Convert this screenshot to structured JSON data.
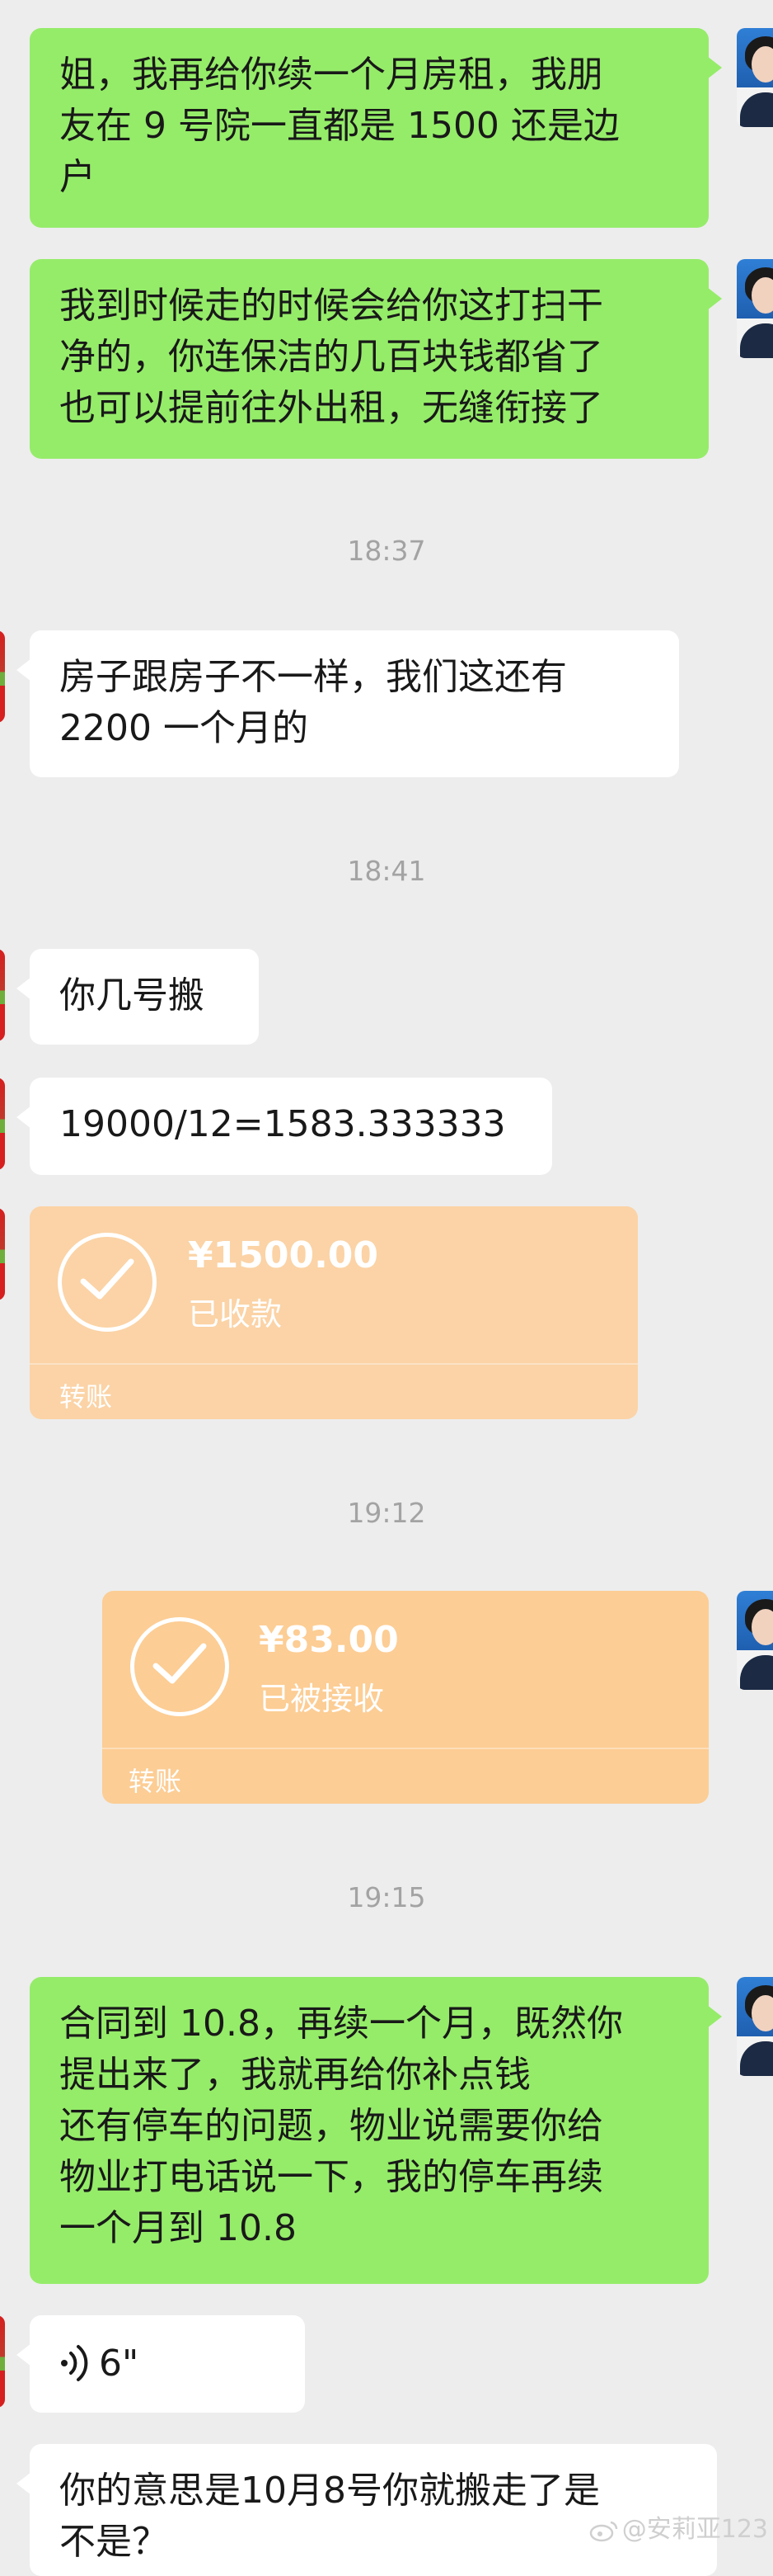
{
  "messages": [
    {
      "id": "m1",
      "side": "right",
      "text": "姐，我再给你续一个月房租，我朋\n友在 9 号院一直都是 1500 还是边\n户"
    },
    {
      "id": "m2",
      "side": "right",
      "text": "我到时候走的时候会给你这打扫干\n净的，你连保洁的几百块钱都省了\n也可以提前往外出租，无缝衔接了"
    },
    {
      "id": "m3",
      "side": "left",
      "text": "房子跟房子不一样，我们这还有\n2200 一个月的"
    },
    {
      "id": "m4",
      "side": "left",
      "text": "你几号搬"
    },
    {
      "id": "m5",
      "side": "left",
      "text": "19000/12=1583.333333"
    },
    {
      "id": "m6",
      "side": "right",
      "text": "合同到 10.8，再续一个月，既然你\n提出来了，我就再给你补点钱\n还有停车的问题，物业说需要你给\n物业打电话说一下，我的停车再续\n一个月到 10.8"
    },
    {
      "id": "m7",
      "side": "left",
      "text": "你的意思是10月8号你就搬走了是\n不是？"
    }
  ],
  "timestamps": [
    "18:37",
    "18:41",
    "19:12",
    "19:15"
  ],
  "transfers": [
    {
      "side": "left",
      "amount": "¥1500.00",
      "status": "已收款",
      "label": "转账"
    },
    {
      "side": "right",
      "amount": "¥83.00",
      "status": "已被接收",
      "label": "转账"
    }
  ],
  "voice": {
    "duration": "6\""
  },
  "watermark": {
    "text": "@安莉亚123"
  },
  "colors": {
    "background": "#ededed",
    "bubble_right": "#95ec69",
    "bubble_left": "#ffffff",
    "transfer": "#fccd94"
  }
}
